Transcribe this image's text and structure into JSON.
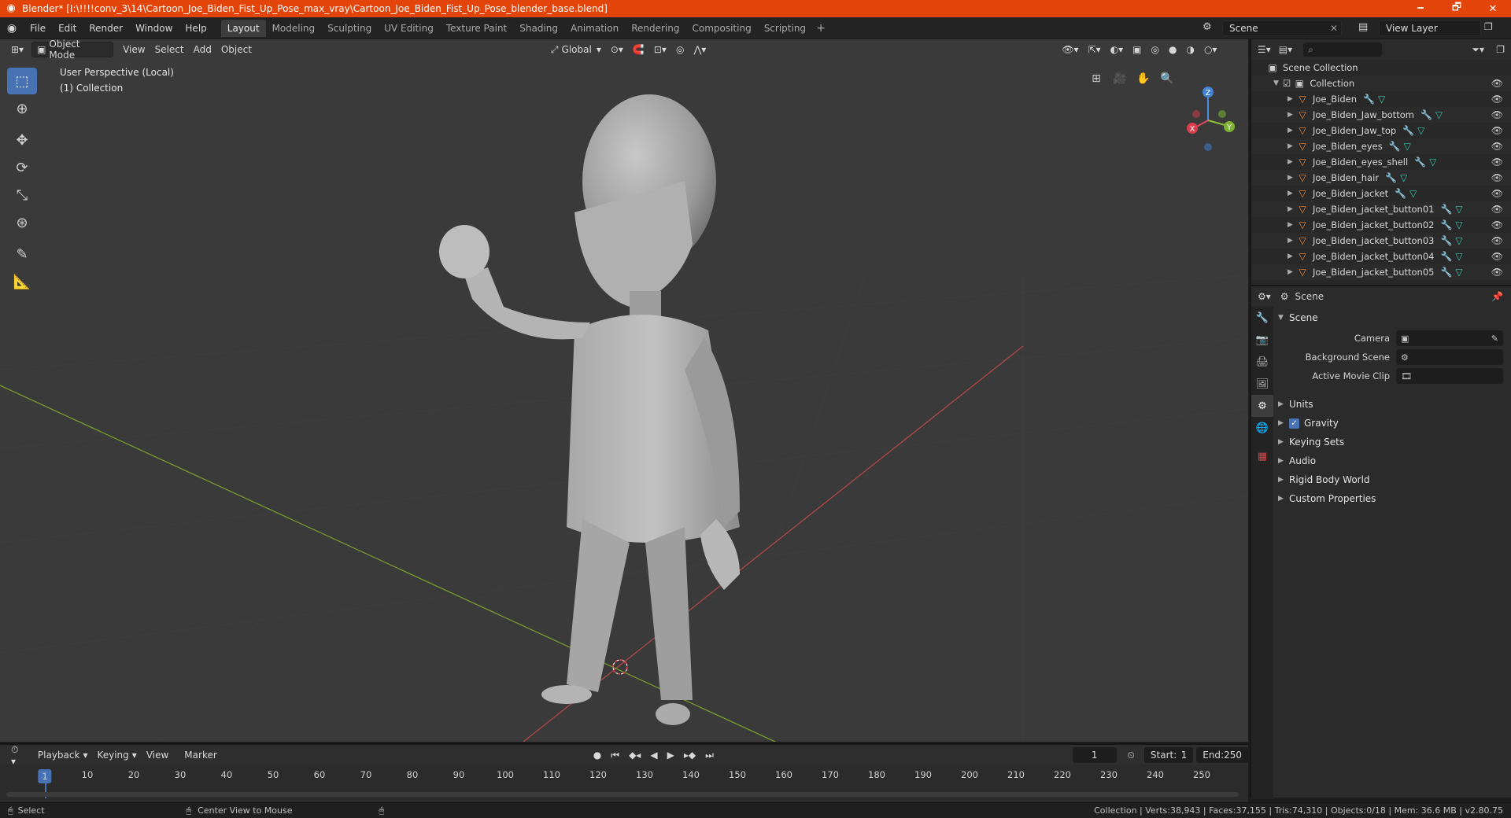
{
  "window": {
    "title": "Blender* [I:\\!!!!conv_3\\14\\Cartoon_Joe_Biden_Fist_Up_Pose_max_vray\\Cartoon_Joe_Biden_Fist_Up_Pose_blender_base.blend]",
    "minimize": "🗕",
    "maximize": "🗗",
    "close": "✕"
  },
  "menu": [
    "File",
    "Edit",
    "Render",
    "Window",
    "Help"
  ],
  "workspaces": [
    "Layout",
    "Modeling",
    "Sculpting",
    "UV Editing",
    "Texture Paint",
    "Shading",
    "Animation",
    "Rendering",
    "Compositing",
    "Scripting"
  ],
  "active_workspace": "Layout",
  "scene_name": "Scene",
  "view_layer": "View Layer",
  "viewport_header": {
    "mode": "Object Mode",
    "menus": [
      "View",
      "Select",
      "Add",
      "Object"
    ],
    "orientation": "Global"
  },
  "viewport_info": {
    "perspective": "User Perspective (Local)",
    "collection": "(1) Collection"
  },
  "gizmo_axes": {
    "x": "X",
    "y": "Y",
    "z": "Z"
  },
  "outliner": {
    "root": "Scene Collection",
    "collection": "Collection",
    "objects": [
      "Joe_Biden",
      "Joe_Biden_Jaw_bottom",
      "Joe_Biden_Jaw_top",
      "Joe_Biden_eyes",
      "Joe_Biden_eyes_shell",
      "Joe_Biden_hair",
      "Joe_Biden_jacket",
      "Joe_Biden_jacket_button01",
      "Joe_Biden_jacket_button02",
      "Joe_Biden_jacket_button03",
      "Joe_Biden_jacket_button04",
      "Joe_Biden_jacket_button05"
    ]
  },
  "properties": {
    "context": "Scene",
    "section": "Scene",
    "camera_label": "Camera",
    "background_scene_label": "Background Scene",
    "active_clip_label": "Active Movie Clip",
    "panels": [
      "Units",
      "Gravity",
      "Keying Sets",
      "Audio",
      "Rigid Body World",
      "Custom Properties"
    ],
    "gravity_checked": true
  },
  "timeline": {
    "menus": [
      "Playback",
      "Keying",
      "View",
      "Marker"
    ],
    "current_frame": "1",
    "start_label": "Start:",
    "start": "1",
    "end_label": "End:",
    "end": "250",
    "ruler": [
      "10",
      "20",
      "30",
      "40",
      "50",
      "60",
      "70",
      "80",
      "90",
      "100",
      "110",
      "120",
      "130",
      "140",
      "150",
      "160",
      "170",
      "180",
      "190",
      "200",
      "210",
      "220",
      "230",
      "240",
      "250"
    ],
    "ruler_current": "1"
  },
  "status": {
    "left1": "Select",
    "left2": "Center View to Mouse",
    "right": "Collection | Verts:38,943 | Faces:37,155 | Tris:74,310 | Objects:0/18 | Mem: 36.6 MB | v2.80.75"
  }
}
